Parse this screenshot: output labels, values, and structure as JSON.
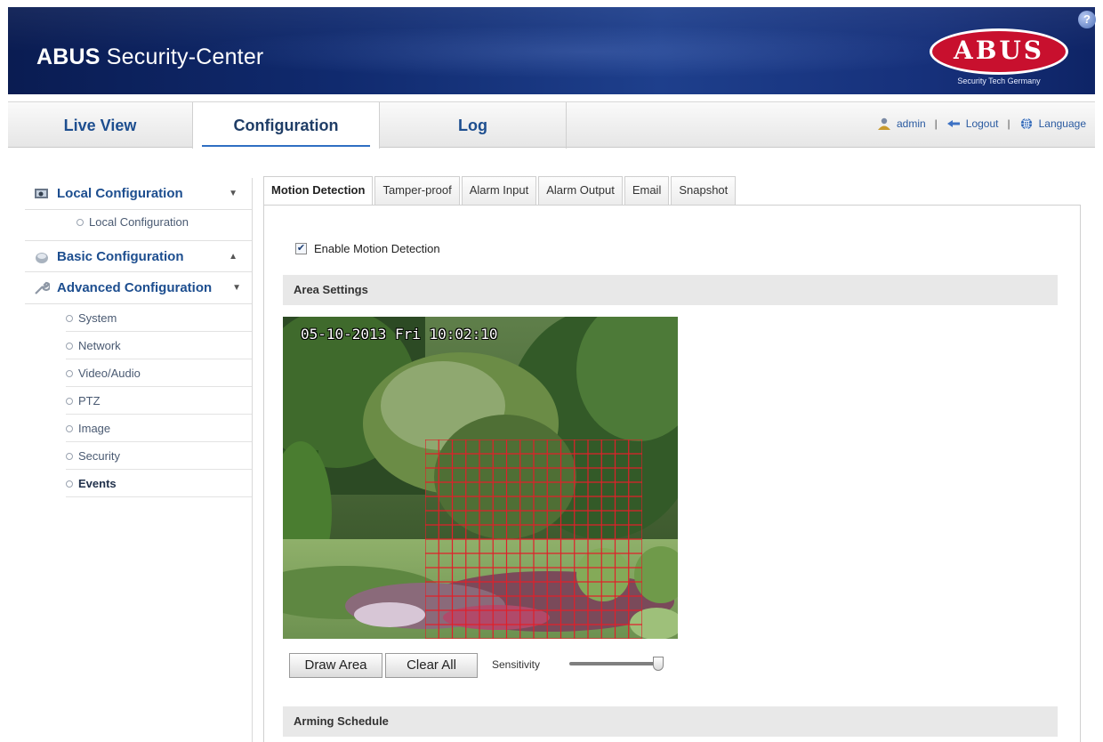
{
  "header": {
    "app_title_bold": "ABUS",
    "app_title_rest": " Security-Center",
    "logo_text": "ABUS",
    "logo_tagline": "Security Tech Germany",
    "help_glyph": "?"
  },
  "nav": {
    "tabs": [
      {
        "label": "Live View"
      },
      {
        "label": "Configuration"
      },
      {
        "label": "Log"
      }
    ],
    "active_tab": "Configuration",
    "user": "admin",
    "logout": "Logout",
    "language": "Language",
    "separator": "|"
  },
  "sidebar": {
    "local_configuration": "Local Configuration",
    "local_configuration_sub": "Local Configuration",
    "basic_configuration": "Basic Configuration",
    "advanced_configuration": "Advanced Configuration",
    "advanced_items": [
      {
        "label": "System"
      },
      {
        "label": "Network"
      },
      {
        "label": "Video/Audio"
      },
      {
        "label": "PTZ"
      },
      {
        "label": "Image"
      },
      {
        "label": "Security"
      },
      {
        "label": "Events"
      }
    ],
    "active_item": "Events"
  },
  "content": {
    "tabs": [
      {
        "label": "Motion Detection"
      },
      {
        "label": "Tamper-proof"
      },
      {
        "label": "Alarm Input"
      },
      {
        "label": "Alarm Output"
      },
      {
        "label": "Email"
      },
      {
        "label": "Snapshot"
      }
    ],
    "active_tab": "Motion Detection",
    "enable_label": "Enable Motion Detection",
    "enable_checked": true,
    "area_settings": "Area Settings",
    "osd_timestamp": "05-10-2013 Fri 10:02:10",
    "draw_area": "Draw Area",
    "clear_all": "Clear All",
    "sensitivity_label": "Sensitivity",
    "sensitivity_level": 1.0,
    "arming_schedule": "Arming Schedule"
  },
  "colors": {
    "banner": "#102a6e",
    "link": "#1d4e8f",
    "logo_red": "#c8102e",
    "grid_red": "#e0202a"
  }
}
